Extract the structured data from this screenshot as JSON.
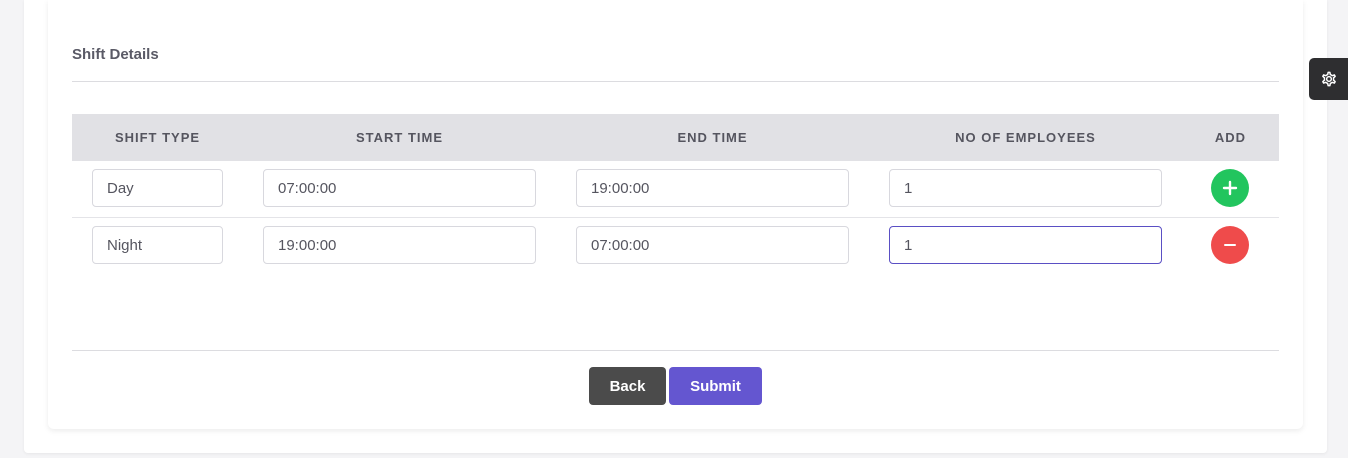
{
  "section": {
    "title": "Shift Details"
  },
  "table": {
    "headers": [
      "SHIFT TYPE",
      "START TIME",
      "END TIME",
      "NO OF EMPLOYEES",
      "ADD"
    ],
    "rows": [
      {
        "shift_type": "Day",
        "start_time": "07:00:00",
        "end_time": "19:00:00",
        "employees": "1",
        "action": "add"
      },
      {
        "shift_type": "Night",
        "start_time": "19:00:00",
        "end_time": "07:00:00",
        "employees": "1",
        "action": "remove"
      }
    ]
  },
  "buttons": {
    "back": "Back",
    "submit": "Submit"
  },
  "icons": {
    "add": "plus-icon",
    "remove": "minus-icon",
    "settings": "gear-icon"
  },
  "colors": {
    "add": "#22c55e",
    "remove": "#ef4b4b",
    "primary": "#6456d0",
    "back": "#4b4b4b"
  }
}
